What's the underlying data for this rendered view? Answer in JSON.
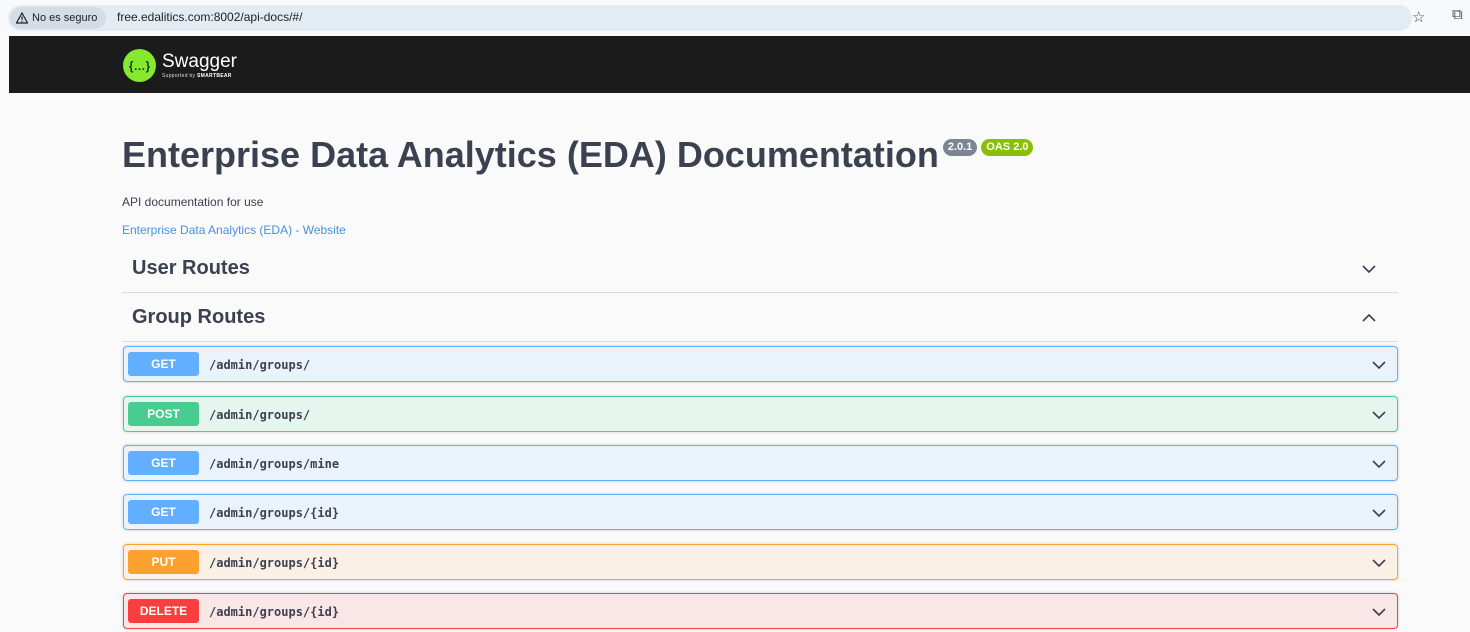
{
  "browser": {
    "security_label": "No es seguro",
    "url": "free.edalitics.com:8002/api-docs/#/"
  },
  "topbar": {
    "logo_name": "Swagger",
    "logo_sub_prefix": "Supported by",
    "logo_sub_brand": "SMARTBEAR"
  },
  "info": {
    "title": "Enterprise Data Analytics (EDA) Documentation",
    "version": "2.0.1",
    "oas": "OAS 2.0",
    "description": "API documentation for use",
    "link_text": "Enterprise Data Analytics (EDA) - Website"
  },
  "tags": [
    {
      "name": "User Routes",
      "expanded": false
    },
    {
      "name": "Group Routes",
      "expanded": true
    }
  ],
  "operations": [
    {
      "method": "GET",
      "path": "/admin/groups/",
      "color": "#61affe"
    },
    {
      "method": "POST",
      "path": "/admin/groups/",
      "color": "#49cc90"
    },
    {
      "method": "GET",
      "path": "/admin/groups/mine",
      "color": "#61affe"
    },
    {
      "method": "GET",
      "path": "/admin/groups/{id}",
      "color": "#61affe"
    },
    {
      "method": "PUT",
      "path": "/admin/groups/{id}",
      "color": "#fca130"
    },
    {
      "method": "DELETE",
      "path": "/admin/groups/{id}",
      "color": "#f93e3e"
    }
  ]
}
